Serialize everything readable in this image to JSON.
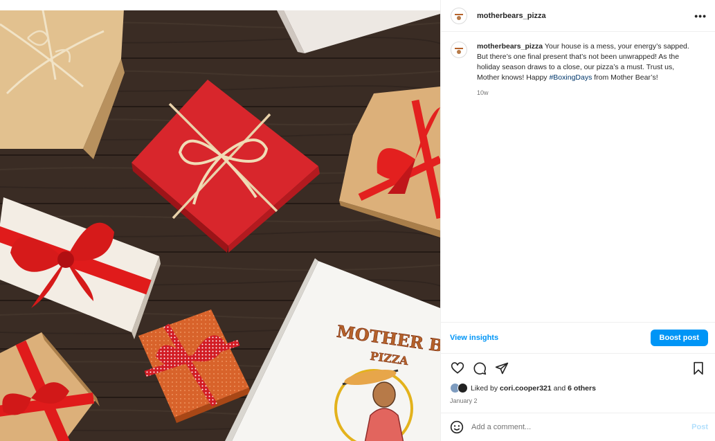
{
  "post": {
    "username": "motherbears_pizza",
    "more_label": "•••",
    "caption": {
      "username": "motherbears_pizza",
      "text_before": " Your house is a mess, your energy’s sapped. But there’s one final present that’s not been unwrapped! As the holiday season draws to a close, our pizza’s a must. Trust us, Mother knows! Happy ",
      "hashtag": "#BoxingDays",
      "text_after": " from Mother Bear’s!",
      "time": "10w"
    },
    "insights": {
      "view_label": "View insights",
      "boost_label": "Boost post"
    },
    "icons": [
      "heart-icon",
      "comment-icon",
      "share-icon",
      "bookmark-icon",
      "emoji-icon"
    ],
    "likes": {
      "prefix": "Liked by ",
      "user": "cori.cooper321",
      "middle": " and ",
      "others": "6 others"
    },
    "date": "January 2",
    "comment": {
      "placeholder": "Add a comment...",
      "post_label": "Post"
    },
    "image": {
      "logo_line1": "MOTHER BEAR'S",
      "logo_line2": "PIZZA"
    }
  },
  "colors": {
    "accent": "#0095f6",
    "wood": "#3c2e26",
    "gift_red": "#d8262c",
    "kraft": "#d9b27e",
    "ribbon_red": "#e01b1b"
  }
}
